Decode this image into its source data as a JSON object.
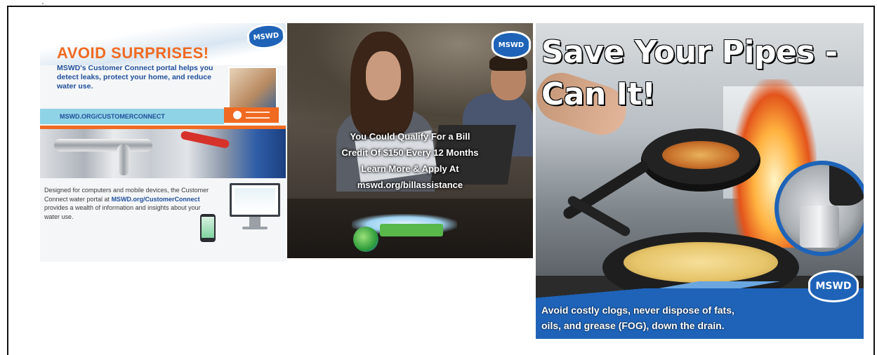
{
  "panel1": {
    "logo": "MSWD",
    "headline": "AVOID SURPRISES!",
    "body": "MSWD's Customer Connect portal helps you detect leaks, protect your home, and reduce water use.",
    "url": "MSWD.ORG/CUSTOMERCONNECT",
    "description_prefix": "Designed for computers and mobile devices, the Customer Connect water portal at ",
    "description_link": "MSWD.org/CustomerConnect",
    "description_suffix": " provides a wealth of information and insights about your water use."
  },
  "panel2": {
    "logo": "MSWD",
    "line1": "You Could Qualify For a Bill",
    "line2": "Credit Of $150 Every 12 Months",
    "line3": "Learn More & Apply At",
    "line4": "mswd.org/billassistance"
  },
  "panel3": {
    "title_line1": "Save Your Pipes -",
    "title_line2": "Can It!",
    "caption_line1": "Avoid costly clogs, never dispose of fats,",
    "caption_line2": "oils, and grease (FOG), down the drain.",
    "logo": "MSWD"
  },
  "colors": {
    "orange": "#f06a22",
    "blue": "#1e63b8",
    "navy": "#1f4f9a"
  }
}
